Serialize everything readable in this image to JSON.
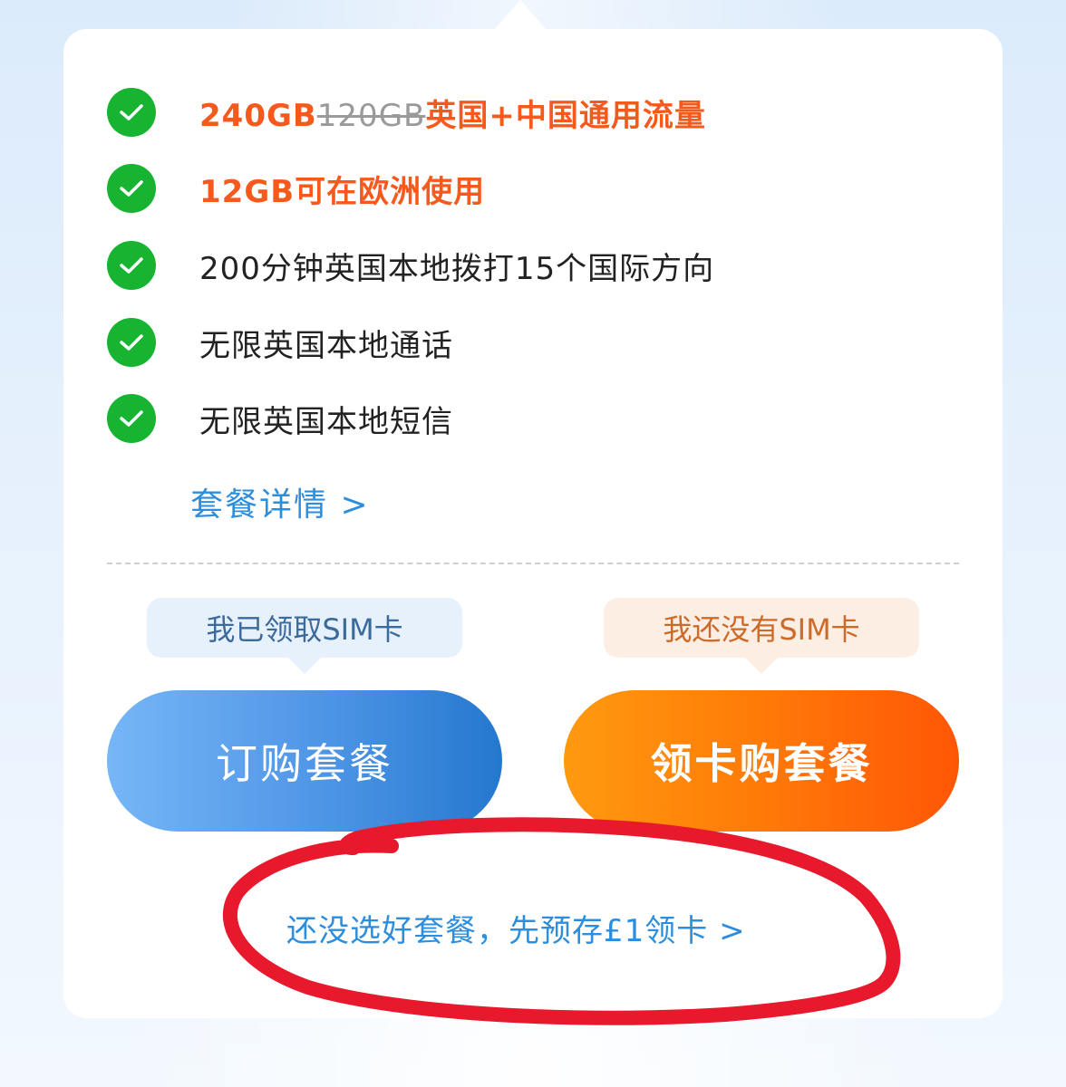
{
  "features": [
    {
      "icon": "check-circle-icon",
      "highlight": true,
      "prefix": "240GB",
      "strike": "120GB",
      "suffix": "英国+中国通用流量"
    },
    {
      "icon": "check-circle-icon",
      "highlight": true,
      "prefix": "12GB可在欧洲使用",
      "strike": "",
      "suffix": ""
    },
    {
      "icon": "check-circle-icon",
      "highlight": false,
      "prefix": "200分钟英国本地拨打15个国际方向",
      "strike": "",
      "suffix": ""
    },
    {
      "icon": "check-circle-icon",
      "highlight": false,
      "prefix": "无限英国本地通话",
      "strike": "",
      "suffix": ""
    },
    {
      "icon": "check-circle-icon",
      "highlight": false,
      "prefix": "无限英国本地短信",
      "strike": "",
      "suffix": ""
    }
  ],
  "details_link": "套餐详情 >",
  "left_option": {
    "tooltip": "我已领取SIM卡",
    "button": "订购套餐"
  },
  "right_option": {
    "tooltip": "我还没有SIM卡",
    "button": "领卡购套餐"
  },
  "prestore_link": "还没选好套餐，先预存£1领卡 >",
  "colors": {
    "check_green": "#16b431",
    "highlight_orange": "#f55a1c",
    "link_blue": "#2d8ede",
    "annotation_red": "#e8192c"
  }
}
